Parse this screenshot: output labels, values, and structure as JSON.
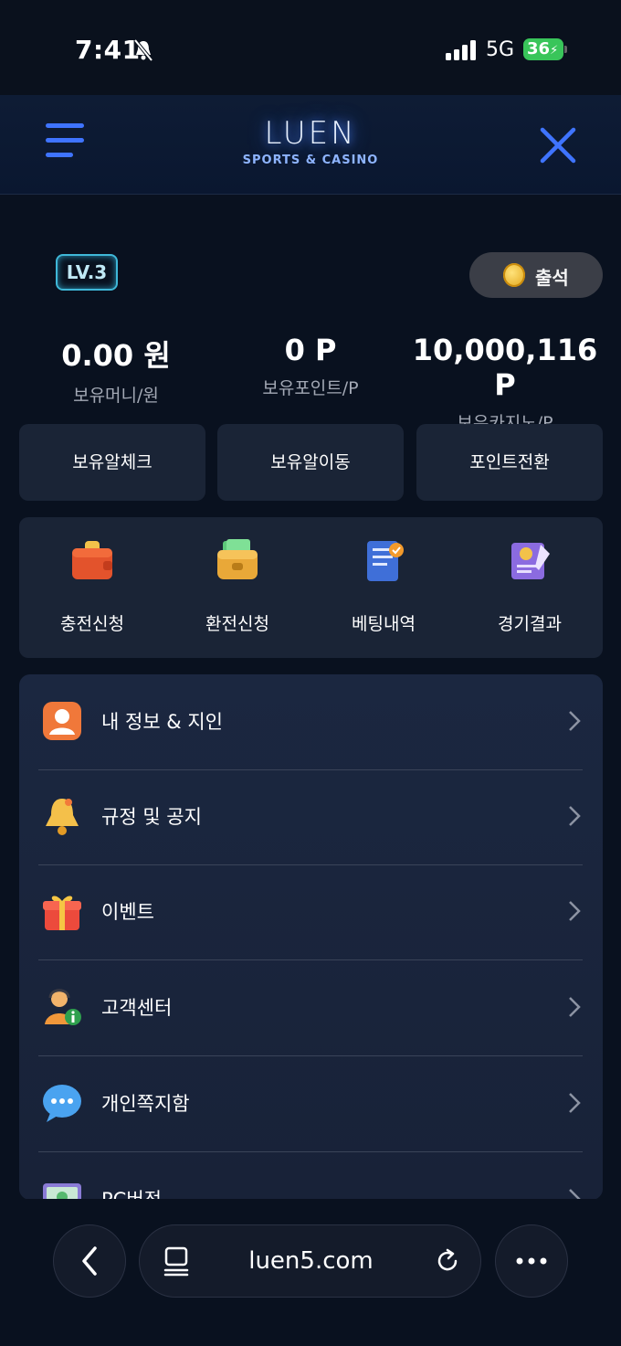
{
  "status_bar": {
    "time": "7:41",
    "network": "5G",
    "battery": "36"
  },
  "header": {
    "brand": "LUEN",
    "tagline": "SPORTS & CASINO"
  },
  "level": {
    "label": "LV.3"
  },
  "attendance": {
    "label": "출석"
  },
  "balances": [
    {
      "value": "0.00 원",
      "caption": "보유머니/원"
    },
    {
      "value": "0 P",
      "caption": "보유포인트/P"
    },
    {
      "value": "10,000,116 P",
      "caption": "보유카지노/P"
    }
  ],
  "actions": [
    "보유알체크",
    "보유알이동",
    "포인트전환"
  ],
  "quick_menu": [
    {
      "label": "충전신청",
      "icon": "wallet-red-icon"
    },
    {
      "label": "환전신청",
      "icon": "wallet-cash-icon"
    },
    {
      "label": "베팅내역",
      "icon": "document-check-icon"
    },
    {
      "label": "경기결과",
      "icon": "certificate-icon"
    }
  ],
  "menu_list": [
    {
      "label": "내 정보 & 지인",
      "icon": "profile-icon"
    },
    {
      "label": "규정 및 공지",
      "icon": "bell-icon"
    },
    {
      "label": "이벤트",
      "icon": "gift-icon"
    },
    {
      "label": "고객센터",
      "icon": "support-agent-icon"
    },
    {
      "label": "개인쪽지함",
      "icon": "chat-bubble-icon"
    },
    {
      "label": "PC버전",
      "icon": "monitor-icon"
    }
  ],
  "browser": {
    "url": "luen5.com"
  },
  "colors": {
    "accent": "#3f74ff",
    "card": "#1a2436",
    "background": "#09111f"
  }
}
